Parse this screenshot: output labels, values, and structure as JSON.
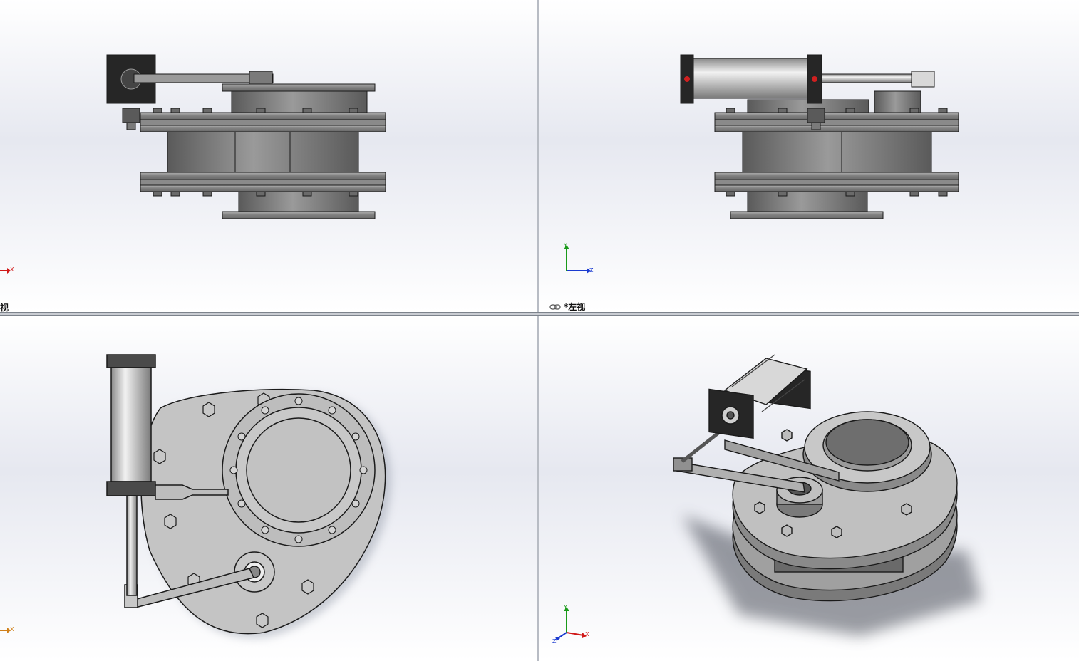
{
  "viewports": {
    "top_left": {
      "label": "视",
      "axis_x": "X"
    },
    "top_right": {
      "label": "*左视",
      "axis_y": "Y",
      "axis_z": "Z"
    },
    "bottom_left": {
      "axis_x": "X"
    },
    "bottom_right": {
      "axis_x": "X",
      "axis_y": "Y",
      "axis_z": "Z"
    }
  },
  "icons": {
    "view_link": "link-icon"
  },
  "colors": {
    "metal_dark": "#5e5e5e",
    "metal_mid": "#8c8c8c",
    "metal_light": "#bdbdbd",
    "cylinder_black": "#2a2a2a",
    "axis_x": "#d01818",
    "axis_y": "#1a9a1a",
    "axis_z": "#1a3ad0"
  }
}
